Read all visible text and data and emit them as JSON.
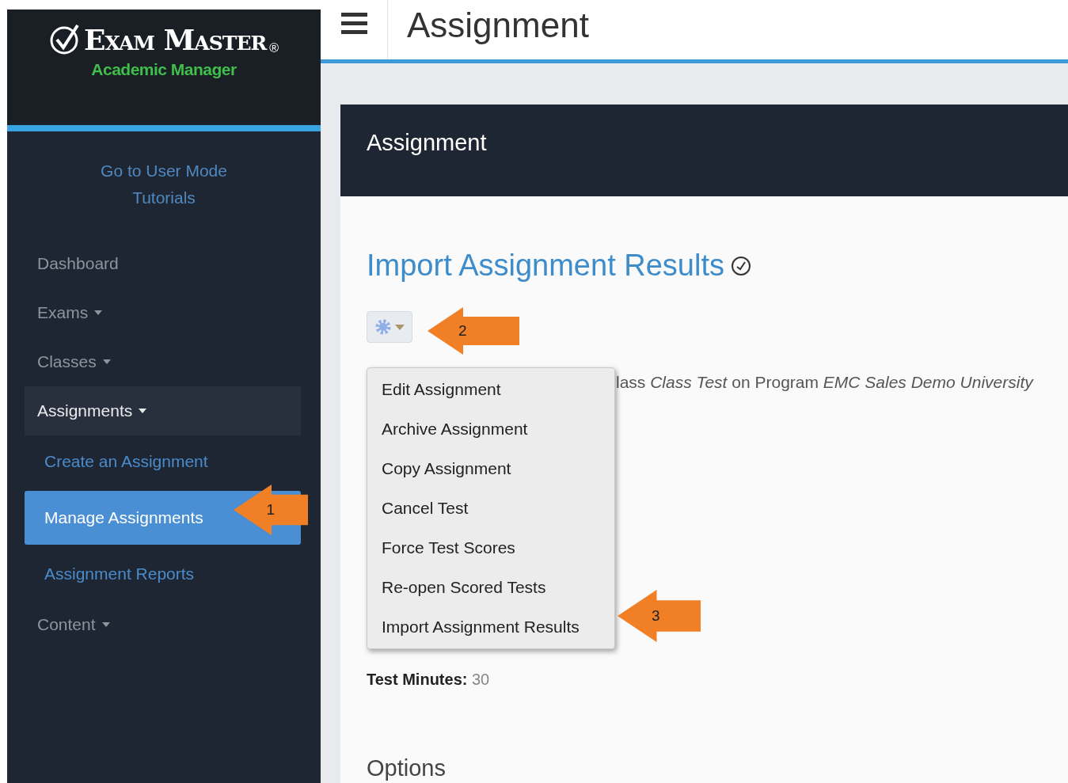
{
  "logo": {
    "title": "Exam Master",
    "mark": "®",
    "subtitle": "Academic Manager"
  },
  "sidebar": {
    "links": [
      "Go to User Mode",
      "Tutorials"
    ],
    "items": [
      {
        "label": "Dashboard",
        "caret": false,
        "expanded": false
      },
      {
        "label": "Exams",
        "caret": true,
        "expanded": false
      },
      {
        "label": "Classes",
        "caret": true,
        "expanded": false
      },
      {
        "label": "Assignments",
        "caret": true,
        "expanded": true,
        "children": [
          {
            "label": "Create an Assignment",
            "selected": false
          },
          {
            "label": "Manage Assignments",
            "selected": true
          },
          {
            "label": "Assignment Reports",
            "selected": false
          }
        ]
      },
      {
        "label": "Content",
        "caret": true,
        "expanded": false
      }
    ]
  },
  "topbar": {
    "title": "Assignment"
  },
  "panel": {
    "title": "Assignment",
    "heading": "Import Assignment Results",
    "detail": "lass *Class Test* on Program *EMC Sales Demo University*",
    "fields": [
      {
        "label": "Test Minutes:",
        "value": "30"
      }
    ],
    "section": "Options"
  },
  "menu": {
    "open": true,
    "items": [
      "Edit Assignment",
      "Archive Assignment",
      "Copy Assignment",
      "Cancel Test",
      "Force Test Scores",
      "Re-open Scored Tests",
      "Import Assignment Results"
    ]
  },
  "callouts": [
    {
      "number": "1"
    },
    {
      "number": "2"
    },
    {
      "number": "3"
    }
  ]
}
